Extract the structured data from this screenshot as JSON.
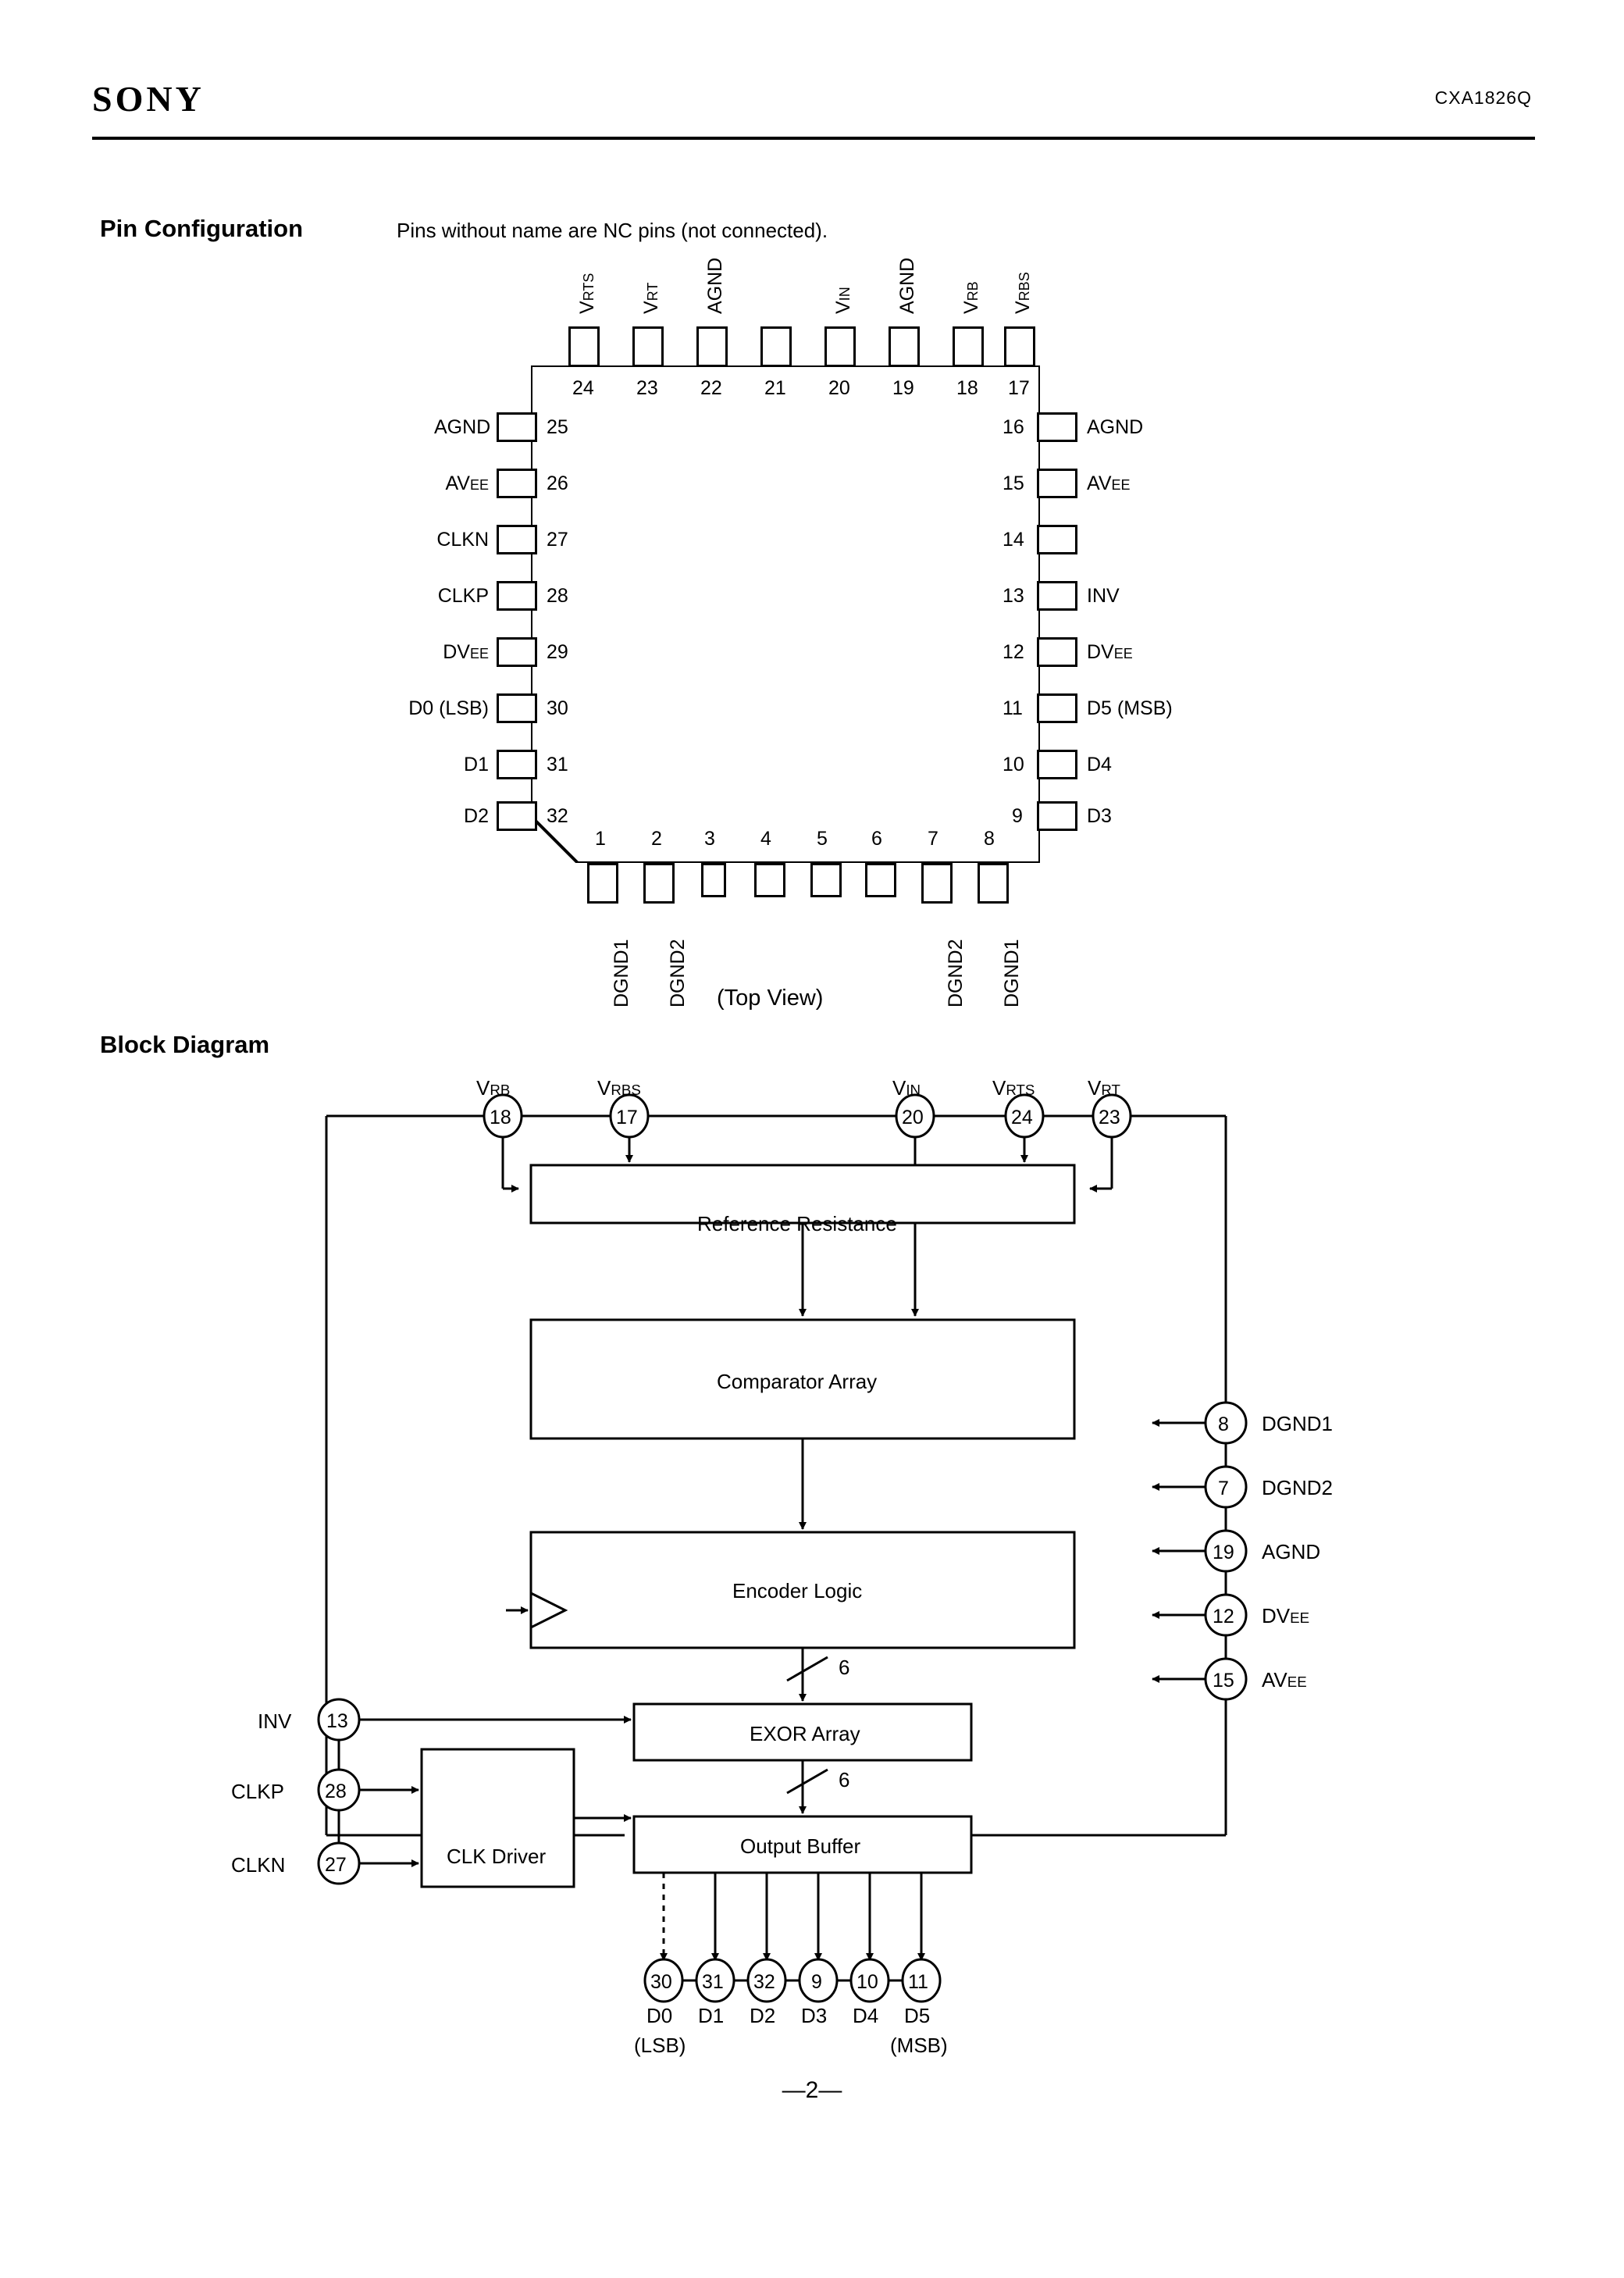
{
  "header": {
    "brand": "SONY",
    "part_number": "CXA1826Q"
  },
  "pin_configuration": {
    "title": "Pin Configuration",
    "note": "Pins without name are NC pins (not connected).",
    "view_label": "(Top View)",
    "top_pins": [
      {
        "number": "24",
        "name": "VRTS"
      },
      {
        "number": "23",
        "name": "VRT"
      },
      {
        "number": "22",
        "name": "AGND"
      },
      {
        "number": "21",
        "name": ""
      },
      {
        "number": "20",
        "name": "VIN"
      },
      {
        "number": "19",
        "name": "AGND"
      },
      {
        "number": "18",
        "name": "VRB"
      },
      {
        "number": "17",
        "name": "VRBS"
      }
    ],
    "left_pins": [
      {
        "number": "25",
        "name": "AGND"
      },
      {
        "number": "26",
        "name": "AVEE"
      },
      {
        "number": "27",
        "name": "CLKN"
      },
      {
        "number": "28",
        "name": "CLKP"
      },
      {
        "number": "29",
        "name": "DVEE"
      },
      {
        "number": "30",
        "name": "D0 (LSB)"
      },
      {
        "number": "31",
        "name": "D1"
      },
      {
        "number": "32",
        "name": "D2"
      }
    ],
    "right_pins": [
      {
        "number": "16",
        "name": "AGND"
      },
      {
        "number": "15",
        "name": "AVEE"
      },
      {
        "number": "14",
        "name": ""
      },
      {
        "number": "13",
        "name": "INV"
      },
      {
        "number": "12",
        "name": "DVEE"
      },
      {
        "number": "11",
        "name": "D5 (MSB)"
      },
      {
        "number": "10",
        "name": "D4"
      },
      {
        "number": "9",
        "name": "D3"
      }
    ],
    "bottom_pins": [
      {
        "number": "1",
        "name": "DGND1"
      },
      {
        "number": "2",
        "name": "DGND2"
      },
      {
        "number": "3",
        "name": ""
      },
      {
        "number": "4",
        "name": ""
      },
      {
        "number": "5",
        "name": ""
      },
      {
        "number": "6",
        "name": ""
      },
      {
        "number": "7",
        "name": "DGND2"
      },
      {
        "number": "8",
        "name": "DGND1"
      }
    ]
  },
  "block_diagram": {
    "title": "Block Diagram",
    "blocks": [
      {
        "id": "reference-resistance",
        "label": "Reference Resistance"
      },
      {
        "id": "comparator-array",
        "label": "Comparator Array"
      },
      {
        "id": "encoder-logic",
        "label": "Encoder Logic"
      },
      {
        "id": "exor-array",
        "label": "EXOR Array"
      },
      {
        "id": "output-buffer",
        "label": "Output Buffer"
      },
      {
        "id": "clk-driver",
        "label": "CLK Driver"
      }
    ],
    "top_pins": [
      {
        "number": "18",
        "name": "VRB"
      },
      {
        "number": "17",
        "name": "VRBS"
      },
      {
        "number": "20",
        "name": "VIN"
      },
      {
        "number": "24",
        "name": "VRTS"
      },
      {
        "number": "23",
        "name": "VRT"
      }
    ],
    "left_pins": [
      {
        "number": "13",
        "name": "INV"
      },
      {
        "number": "28",
        "name": "CLKP"
      },
      {
        "number": "27",
        "name": "CLKN"
      }
    ],
    "right_pins": [
      {
        "number": "8",
        "name": "DGND1"
      },
      {
        "number": "7",
        "name": "DGND2"
      },
      {
        "number": "19",
        "name": "AGND"
      },
      {
        "number": "12",
        "name": "DVEE"
      },
      {
        "number": "15",
        "name": "AVEE"
      }
    ],
    "output_pins": [
      {
        "number": "30",
        "name": "D0",
        "qualifier": "(LSB)"
      },
      {
        "number": "31",
        "name": "D1",
        "qualifier": ""
      },
      {
        "number": "32",
        "name": "D2",
        "qualifier": ""
      },
      {
        "number": "9",
        "name": "D3",
        "qualifier": ""
      },
      {
        "number": "10",
        "name": "D4",
        "qualifier": ""
      },
      {
        "number": "11",
        "name": "D5",
        "qualifier": "(MSB)"
      }
    ],
    "bus_widths": [
      "6",
      "6"
    ]
  },
  "footer": {
    "page_number": "—2—"
  }
}
